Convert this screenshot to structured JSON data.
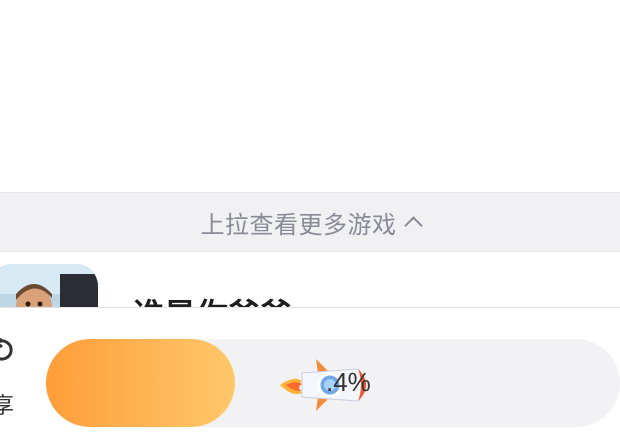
{
  "pull_up": {
    "text": "上拉查看更多游戏"
  },
  "game": {
    "title": "谁是你爸爸"
  },
  "bottom_bar": {
    "share_label": "享",
    "progress": {
      "percent_text": ".4%",
      "fill_fraction": 0.32
    }
  },
  "colors": {
    "accent_orange_start": "#ff9d3a",
    "accent_orange_end": "#ffc86a",
    "track": "#f2f2f4"
  },
  "icons": [
    "chevron-up-icon",
    "share-icon",
    "rocket-icon"
  ]
}
